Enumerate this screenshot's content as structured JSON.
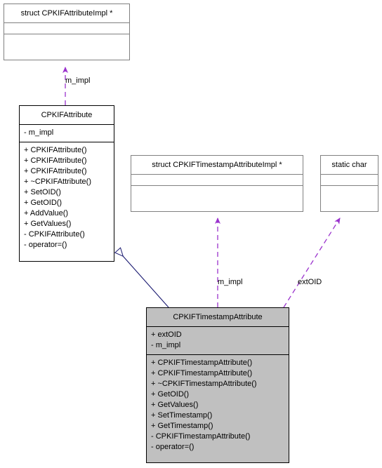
{
  "diagram": {
    "type": "uml-class-diagram",
    "nodes": [
      {
        "id": "struct_attr_impl",
        "title": "struct CPKIFAttributeImpl *",
        "kind": "struct",
        "attributes": [],
        "operations": []
      },
      {
        "id": "cpkif_attribute",
        "title": "CPKIFAttribute",
        "kind": "class",
        "attributes": [
          "- m_impl"
        ],
        "operations": [
          "+ CPKIFAttribute()",
          "+ CPKIFAttribute()",
          "+ CPKIFAttribute()",
          "+ ~CPKIFAttribute()",
          "+ SetOID()",
          "+ GetOID()",
          "+ AddValue()",
          "+ GetValues()",
          "- CPKIFAttribute()",
          "- operator=()"
        ]
      },
      {
        "id": "struct_ts_attr_impl",
        "title": "struct CPKIFTimestampAttributeImpl *",
        "kind": "struct",
        "attributes": [],
        "operations": []
      },
      {
        "id": "static_char",
        "title": "static char",
        "kind": "struct",
        "attributes": [],
        "operations": []
      },
      {
        "id": "cpkif_timestamp_attribute",
        "title": "CPKIFTimestampAttribute",
        "kind": "class",
        "attributes": [
          "+ extOID",
          "- m_impl"
        ],
        "operations": [
          "+ CPKIFTimestampAttribute()",
          "+ CPKIFTimestampAttribute()",
          "+ ~CPKIFTimestampAttribute()",
          "+ GetOID()",
          "+ GetValues()",
          "+ SetTimestamp()",
          "+ GetTimestamp()",
          "- CPKIFTimestampAttribute()",
          "- operator=()"
        ]
      }
    ],
    "edges": [
      {
        "id": "edge_attr_impl",
        "from": "cpkif_attribute",
        "to": "struct_attr_impl",
        "style": "dashed",
        "arrow": "open-triangle",
        "label": "m_impl",
        "color": "#9a32cd"
      },
      {
        "id": "edge_inheritance",
        "from": "cpkif_timestamp_attribute",
        "to": "cpkif_attribute",
        "style": "solid",
        "arrow": "hollow-triangle",
        "label": "",
        "color": "#191970"
      },
      {
        "id": "edge_ts_impl",
        "from": "cpkif_timestamp_attribute",
        "to": "struct_ts_attr_impl",
        "style": "dashed",
        "arrow": "open-triangle",
        "label": "m_impl",
        "color": "#9a32cd"
      },
      {
        "id": "edge_extoid",
        "from": "cpkif_timestamp_attribute",
        "to": "static_char",
        "style": "dashed",
        "arrow": "open-triangle",
        "label": "extOID",
        "color": "#9a32cd"
      }
    ],
    "colors": {
      "class_fill": "#c0c0c0",
      "struct_fill": "#ffffff",
      "usage_edge": "#9a32cd",
      "inheritance_edge": "#191970",
      "struct_border": "#808080",
      "class_border": "#000000"
    }
  }
}
